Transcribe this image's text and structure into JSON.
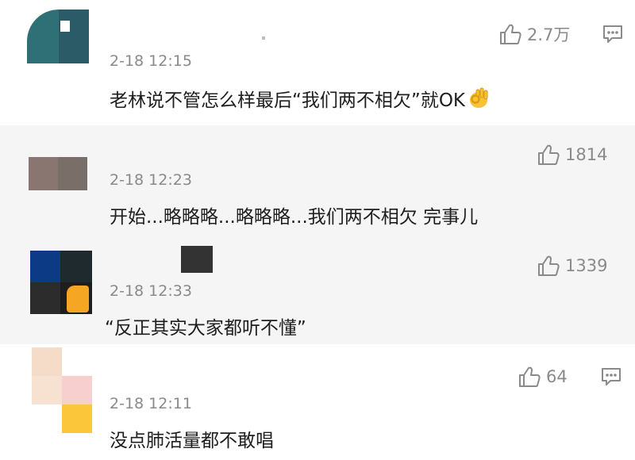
{
  "comments": [
    {
      "time": "2-18 12:15",
      "text": "老林说不管怎么样最后“我们两不相欠”就OK",
      "likes": "2.7万",
      "emoji": "ok-hand",
      "has_reply_icon": true
    },
    {
      "time": "2-18 12:23",
      "text": "开始...略略略...略略略...我们两不相欠 完事儿",
      "likes": "1814",
      "has_reply_icon": false
    },
    {
      "time": "2-18 12:33",
      "text": "“反正其实大家都听不懂”",
      "likes": "1339",
      "has_reply_icon": false
    },
    {
      "time": "2-18 12:11",
      "text": "没点肺活量都不敢唱",
      "likes": "64",
      "has_reply_icon": true
    }
  ],
  "colors": {
    "gray_row": "#f5f5f5",
    "meta_text": "#8a8a8a",
    "body_text": "#1e1e1e",
    "emoji_yellow": "#f7c234"
  }
}
